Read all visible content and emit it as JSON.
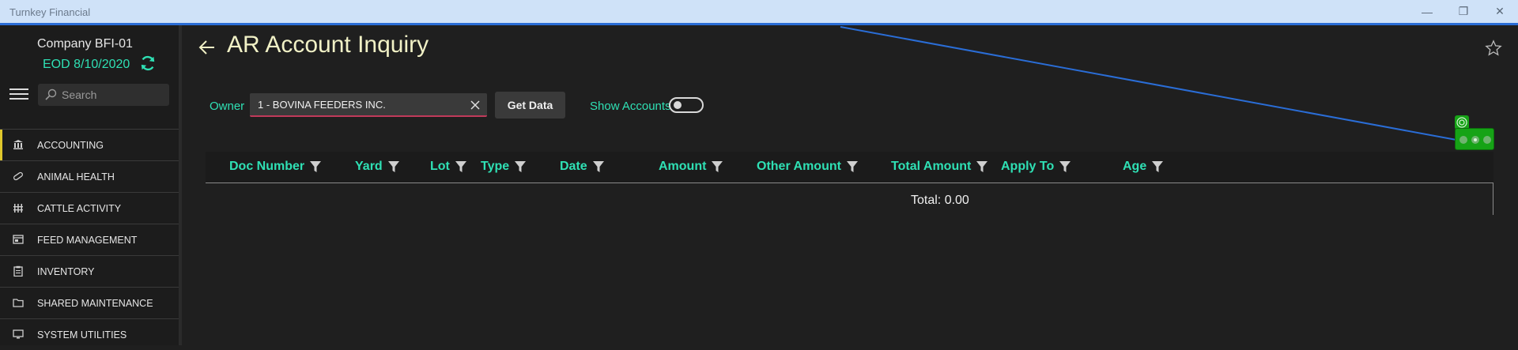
{
  "window": {
    "title": "Turnkey Financial",
    "minimize": "—",
    "maximize": "❐",
    "close": "✕"
  },
  "sidebar": {
    "company": "Company BFI-01",
    "eod": "EOD 8/10/2020",
    "search_placeholder": "Search",
    "items": [
      {
        "label": "ACCOUNTING",
        "icon": "bank-icon",
        "active": true
      },
      {
        "label": "ANIMAL HEALTH",
        "icon": "pill-icon"
      },
      {
        "label": "CATTLE ACTIVITY",
        "icon": "fence-icon"
      },
      {
        "label": "FEED MANAGEMENT",
        "icon": "feed-icon"
      },
      {
        "label": "INVENTORY",
        "icon": "clipboard-icon"
      },
      {
        "label": "SHARED MAINTENANCE",
        "icon": "folder-icon"
      },
      {
        "label": "SYSTEM UTILITIES",
        "icon": "monitor-icon"
      }
    ]
  },
  "main": {
    "title": "AR Account Inquiry",
    "owner_label": "Owner",
    "owner_value": "1 - BOVINA FEEDERS INC.",
    "get_data_label": "Get Data",
    "show_accounts_label": "Show Accounts",
    "show_accounts_on": false,
    "columns": [
      "Doc Number",
      "Yard",
      "Lot",
      "Type",
      "Date",
      "Amount",
      "Other Amount",
      "Total Amount",
      "Apply To",
      "Age"
    ],
    "total": "Total: 0.00"
  },
  "colors": {
    "accent": "#2fe0b4",
    "title": "#f1f1c6",
    "titlebar": "#cfe2f8",
    "active_marker": "#e0c72c"
  }
}
